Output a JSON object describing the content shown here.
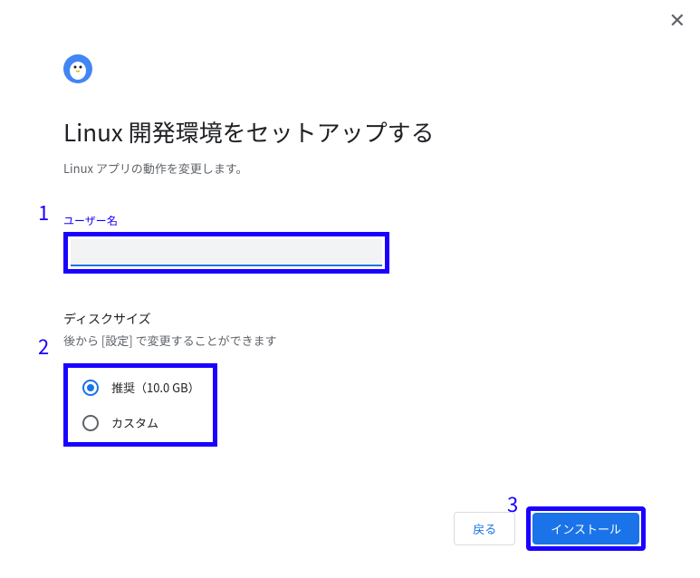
{
  "header": {
    "title": "Linux 開発環境をセットアップする",
    "subtitle": "Linux アプリの動作を変更します。"
  },
  "username": {
    "label": "ユーザー名",
    "value": ""
  },
  "disk": {
    "label": "ディスクサイズ",
    "sublabel": "後から [設定] で変更することができます",
    "options": {
      "recommended": "推奨（10.0 GB）",
      "custom": "カスタム"
    }
  },
  "footer": {
    "back": "戻る",
    "install": "インストール"
  },
  "annotations": {
    "one": "1",
    "two": "2",
    "three": "3"
  }
}
